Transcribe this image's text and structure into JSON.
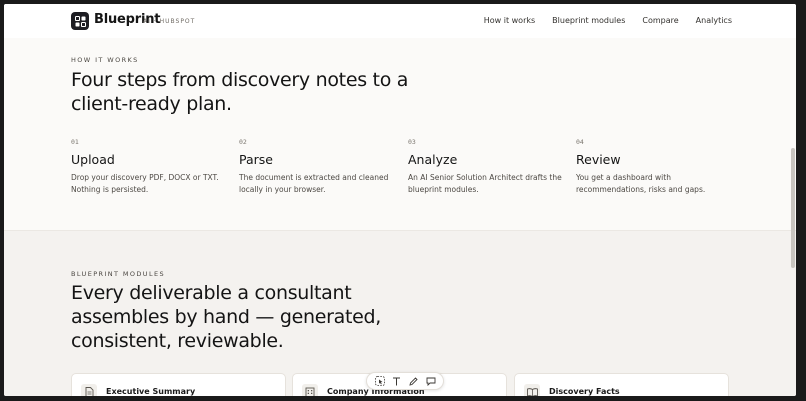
{
  "nav": {
    "brand": "Blueprint",
    "brand_sub": "AI · HUBSPOT",
    "links": [
      "How it works",
      "Blueprint modules",
      "Compare",
      "Analytics"
    ]
  },
  "how": {
    "eyebrow": "HOW IT WORKS",
    "heading_line1": "Four steps from discovery notes to a",
    "heading_line2": "client-ready plan.",
    "steps": [
      {
        "num": "01",
        "title": "Upload",
        "desc_line1": "Drop your discovery PDF, DOCX or TXT.",
        "desc_line2": "Nothing is persisted."
      },
      {
        "num": "02",
        "title": "Parse",
        "desc_line1": "The document is extracted and cleaned",
        "desc_line2": "locally in your browser."
      },
      {
        "num": "03",
        "title": "Analyze",
        "desc_line1": "An AI Senior Solution Architect drafts the",
        "desc_line2": "blueprint modules."
      },
      {
        "num": "04",
        "title": "Review",
        "desc_line1": "You get a dashboard with",
        "desc_line2": "recommendations, risks and gaps."
      }
    ]
  },
  "modules": {
    "eyebrow": "BLUEPRINT MODULES",
    "heading_line1": "Every deliverable a consultant",
    "heading_line2": "assembles by hand — generated,",
    "heading_line3": "consistent, reviewable.",
    "cards": [
      {
        "title": "Executive Summary",
        "icon": "document-icon"
      },
      {
        "title": "Company Information",
        "icon": "building-icon"
      },
      {
        "title": "Discovery Facts",
        "icon": "book-icon"
      }
    ]
  },
  "toolbar": {
    "tools": [
      "select-tool-icon",
      "text-tool-icon",
      "pen-tool-icon",
      "comment-tool-icon"
    ]
  }
}
